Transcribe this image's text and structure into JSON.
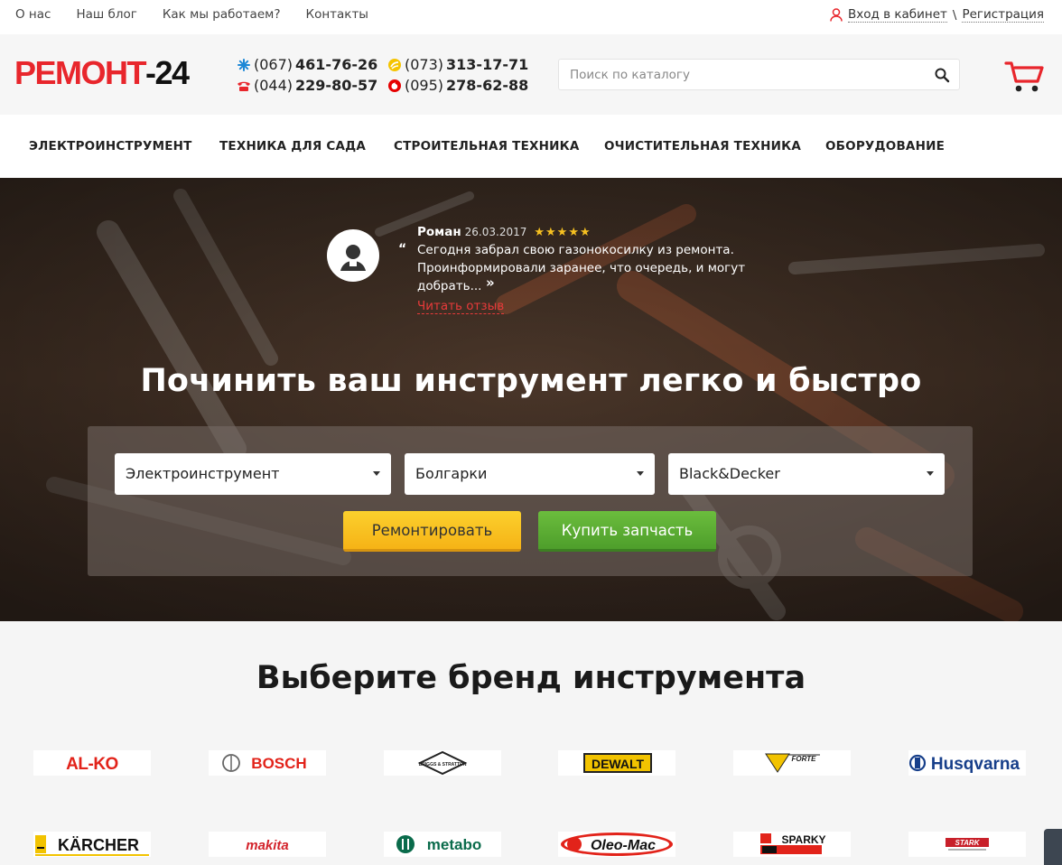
{
  "topnav": [
    "О нас",
    "Наш блог",
    "Как мы работаем?",
    "Контакты"
  ],
  "auth": {
    "login": "Вход в кабинет",
    "sep": "\\",
    "register": "Регистрация"
  },
  "logo": {
    "part1": "РЕМОНТ",
    "part2": "-24"
  },
  "phones": [
    {
      "code": "(067)",
      "num": "461-76-26",
      "operator": "kyivstar-icon"
    },
    {
      "code": "(044)",
      "num": "229-80-57",
      "operator": "landline-phone-icon"
    },
    {
      "code": "(073)",
      "num": "313-17-71",
      "operator": "lifecell-icon"
    },
    {
      "code": "(095)",
      "num": "278-62-88",
      "operator": "vodafone-icon"
    }
  ],
  "search": {
    "placeholder": "Поиск по каталогу"
  },
  "categories": [
    "ЭЛЕКТРОИНСТРУМЕНТ",
    "ТЕХНИКА ДЛЯ САДА",
    "СТРОИТЕЛЬНАЯ ТЕХНИКА",
    "ОЧИСТИТЕЛЬНАЯ ТЕХНИКА",
    "ОБОРУДОВАНИЕ"
  ],
  "review": {
    "author": "Роман",
    "date": "26.03.2017",
    "stars": "★★★★★",
    "rating": 5,
    "open_quote": "“",
    "close_quote": "»",
    "text": "Сегодня забрал свою газонокосилку из ремонта. Проинформировали заранее, что очередь, и могут добрать...",
    "more": "Читать отзыв"
  },
  "hero": {
    "title": "Починить ваш инструмент легко и быстро",
    "select1": "Электроинструмент",
    "select2": "Болгарки",
    "select3": "Black&Decker",
    "btn_repair": "Ремонтировать",
    "btn_buy": "Купить запчасть"
  },
  "brands": {
    "title": "Выберите бренд инструмента",
    "row1": [
      "AL-KO",
      "BOSCH",
      "BRIGGS & STRATTON",
      "DEWALT",
      "FORTE",
      "Husqvarna"
    ],
    "row2": [
      "KÄRCHER",
      "makita",
      "metabo",
      "Oleo-Mac",
      "SPARKY",
      "STARK"
    ]
  },
  "colors": {
    "brand_red": "#e8262c",
    "repair_yellow": "#f6b316",
    "buy_green": "#4e9e2b",
    "star": "#f6c021"
  }
}
